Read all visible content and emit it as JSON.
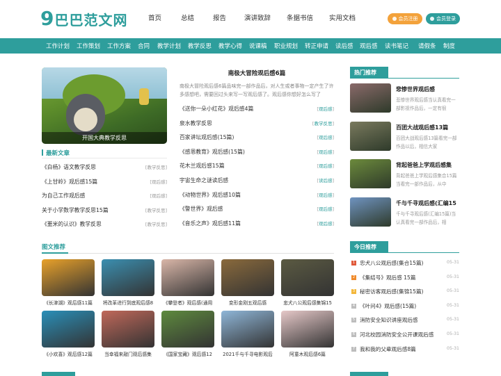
{
  "brand": {
    "logo_num": "9",
    "logo_text": "巴巴范文网",
    "accent": "#2e9e9c",
    "orange": "#f3a23b"
  },
  "topnav": [
    "首页",
    "总结",
    "报告",
    "演讲致辞",
    "条据书信",
    "实用文档"
  ],
  "auth": {
    "register": "会员注册",
    "login": "会员登录"
  },
  "categories": [
    "工作计划",
    "工作策划",
    "工作方案",
    "合同",
    "教学计划",
    "教学反思",
    "教学心得",
    "说课稿",
    "职业规划",
    "转正申请",
    "读后感",
    "观后感",
    "读书笔记",
    "请假条",
    "制度"
  ],
  "hero": {
    "caption": "开国大典教学反思"
  },
  "featured": {
    "title": "南极大冒险观后感6篇",
    "desc": "南极大冒险观后感6篇品味完一部作品后，对人生或者事物一定产生了许多感想吧，需要回过头来写一写观后感了。观后感你想好怎么写了"
  },
  "midlist": [
    {
      "title": "《送你一朵小红花》观后感4篇",
      "tag": "观后感"
    },
    {
      "title": "泉水教学反思",
      "tag": "教学反思"
    },
    {
      "title": "百家讲坛观后感(15篇)",
      "tag": "观后感"
    },
    {
      "title": "《感恩教育》观后感(15篇)",
      "tag": "观后感"
    },
    {
      "title": "花木兰观后感15篇",
      "tag": "观后感"
    },
    {
      "title": "宇宙生命之谜读后感",
      "tag": "读后感"
    },
    {
      "title": "《动物世界》观后感10篇",
      "tag": "观后感"
    },
    {
      "title": "《警世界》观后感",
      "tag": "观后感"
    },
    {
      "title": "《音乐之声》观后感11篇",
      "tag": "观后感"
    }
  ],
  "latest": {
    "heading": "最新文章",
    "items": [
      {
        "title": "《白杨》语文教学反思",
        "tag": "[教学反思]"
      },
      {
        "title": "《上甘岭》观后感15篇",
        "tag": "[观后感]"
      },
      {
        "title": "为自己工作观后感",
        "tag": "[观后感]"
      },
      {
        "title": "关于小学数学教学反思15篇",
        "tag": "[教学反思]"
      },
      {
        "title": "《噩米的认识》教学反思",
        "tag": "[教学反思]"
      }
    ]
  },
  "pics": {
    "heading": "图文推荐",
    "items": [
      {
        "caption": "《长津湖》观后感11篇",
        "color": "#e8a12a"
      },
      {
        "caption": "将改革进行到底观后感8",
        "color": "#3b8fb0"
      },
      {
        "caption": "《攀登者》观后感(通用",
        "color": "#d9b6a8"
      },
      {
        "caption": "变形金刚五观后感",
        "color": "#8a6a3c"
      },
      {
        "caption": "忠犬八公观后感集锦15",
        "color": "#5b5a42"
      },
      {
        "caption": "《小欢喜》观后感12篇",
        "color": "#2a8fb8"
      },
      {
        "caption": "当幸福来敲门观后感集",
        "color": "#c0685a"
      },
      {
        "caption": "《国家宝藏》观后感12",
        "color": "#5e8a3e"
      },
      {
        "caption": "2021千与千寻电影观后",
        "color": "#8fb6d8"
      },
      {
        "caption": "阿童木观后感6篇",
        "color": "#e6c8c8"
      }
    ]
  },
  "hot": {
    "heading": "热门推荐",
    "items": [
      {
        "title": "悲惨世界观后感",
        "desc": "悲惨世界观后感当认真看完一部影视作品后，一定有很",
        "color": "#8a6a6a"
      },
      {
        "title": "百团大战观后感13篇",
        "desc": "百团大战观后感13篇看完一部作品以后，相信大家",
        "color": "#7a7a5e"
      },
      {
        "title": "背起爸爸上学观后感集",
        "desc": "背起爸爸上学观后感集合15篇当看完一部作品后，从中",
        "color": "#6c8a3c"
      },
      {
        "title": "千与千寻观后感(汇编15",
        "desc": "千与千寻观后感(汇编15篇)当认真看完一部作品后，相",
        "color": "#6f93c0"
      }
    ]
  },
  "today": {
    "heading": "今日推荐",
    "items": [
      {
        "num": "1",
        "title": "忠犬八公观后感(集合15篇)",
        "date": "05-31",
        "color": "#e0593a"
      },
      {
        "num": "2",
        "title": "《集结号》观后感 15篇",
        "date": "05-31",
        "color": "#f08a2a"
      },
      {
        "num": "3",
        "title": "秘密访客观后感(集锦15篇)",
        "date": "05-31",
        "color": "#f3b73a"
      },
      {
        "num": "4",
        "title": "《叶问4》观后感(15篇)",
        "date": "05-31",
        "color": "#bdbdbd"
      },
      {
        "num": "5",
        "title": "消防安全知识讲座观后感",
        "date": "05-31",
        "color": "#bdbdbd"
      },
      {
        "num": "6",
        "title": "河北校园消防安全公开课观后感",
        "date": "05-31",
        "color": "#bdbdbd"
      },
      {
        "num": "7",
        "title": "我和我的父辈观后感8篇",
        "date": "05-31",
        "color": "#bdbdbd"
      }
    ]
  }
}
